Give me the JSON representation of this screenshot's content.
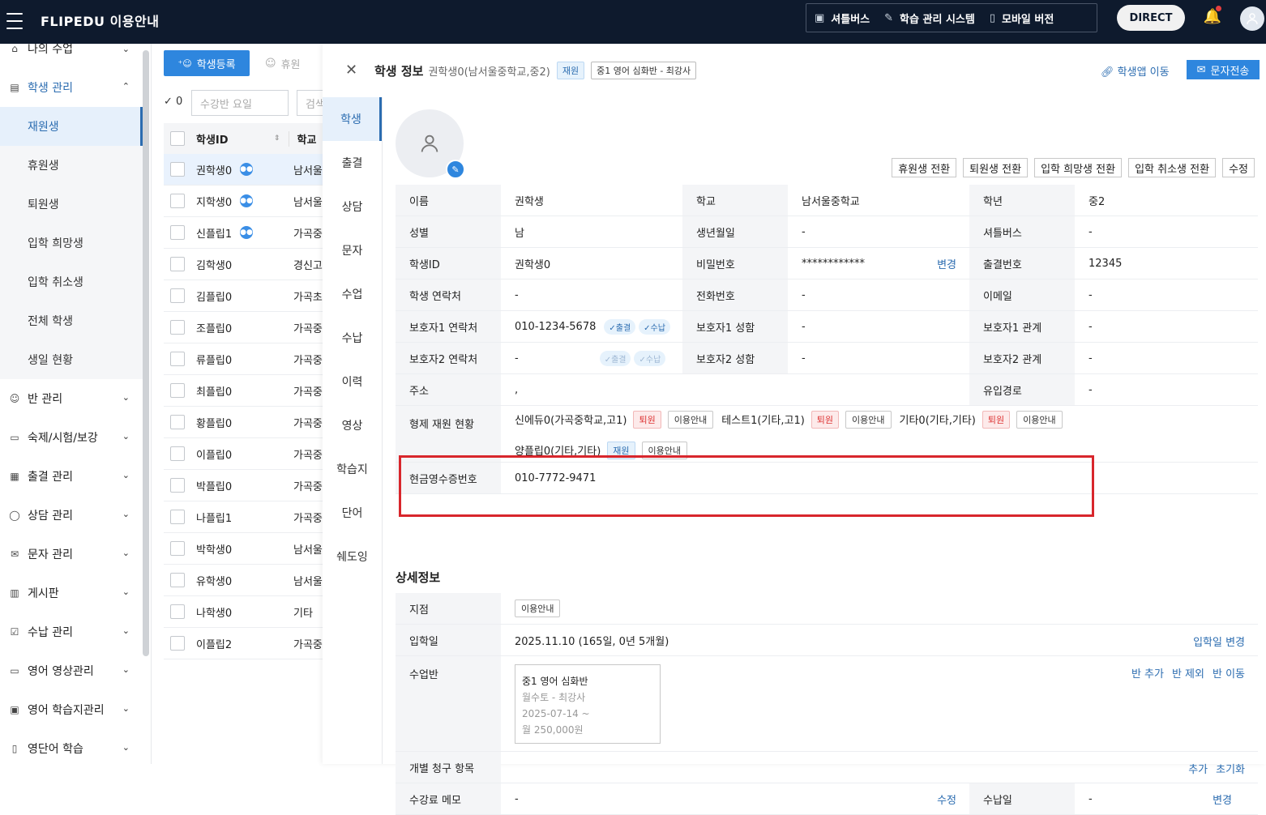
{
  "app": {
    "title": "FLIPEDU 이용안내"
  },
  "topnav": {
    "shuttle": "셔틀버스",
    "lms": "학습 관리 시스템",
    "mobile": "모바일 버전",
    "direct": "DIRECT"
  },
  "sidebar": {
    "my_class": "나의 수업",
    "student_mgmt": "학생 관리",
    "sub": [
      "재원생",
      "휴원생",
      "퇴원생",
      "입학 희망생",
      "입학 취소생",
      "전체 학생",
      "생일 현황"
    ],
    "sections": [
      "반 관리",
      "숙제/시험/보강",
      "출결 관리",
      "상담 관리",
      "문자 관리",
      "게시판",
      "수납 관리",
      "영어 영상관리",
      "영어 학습지관리",
      "영단어 학습"
    ]
  },
  "list": {
    "register": "학생등록",
    "leave": "휴원",
    "check_count": "0",
    "day_placeholder": "수강반 요일",
    "search_placeholder": "검색",
    "col_id": "학생ID",
    "col_school": "학교",
    "rows": [
      {
        "id": "권학생0",
        "school": "남서울",
        "sibling": true
      },
      {
        "id": "지학생0",
        "school": "남서울",
        "sibling": true
      },
      {
        "id": "신플립1",
        "school": "가곡중",
        "sibling": true
      },
      {
        "id": "김학생0",
        "school": "경신고",
        "sibling": false
      },
      {
        "id": "김플립0",
        "school": "가곡초",
        "sibling": false
      },
      {
        "id": "조플립0",
        "school": "가곡중",
        "sibling": false
      },
      {
        "id": "류플립0",
        "school": "가곡중",
        "sibling": false
      },
      {
        "id": "최플립0",
        "school": "가곡중",
        "sibling": false
      },
      {
        "id": "황플립0",
        "school": "가곡중",
        "sibling": false
      },
      {
        "id": "이플립0",
        "school": "가곡중",
        "sibling": false
      },
      {
        "id": "박플립0",
        "school": "가곡중",
        "sibling": false
      },
      {
        "id": "나플립1",
        "school": "가곡중",
        "sibling": false
      },
      {
        "id": "박학생0",
        "school": "남서울",
        "sibling": false
      },
      {
        "id": "유학생0",
        "school": "남서울",
        "sibling": false
      },
      {
        "id": "나학생0",
        "school": "기타",
        "sibling": false
      },
      {
        "id": "이플립2",
        "school": "가곡중",
        "sibling": false
      }
    ]
  },
  "panel": {
    "title": "학생 정보",
    "subtitle": "권학생0(남서울중학교,중2)",
    "status_badge": "재원",
    "class_badge": "중1 영어 심화반 - 최강사",
    "app_move": "학생앱 이동",
    "sms": "문자전송",
    "tabs": [
      "학생",
      "출결",
      "상담",
      "문자",
      "수업",
      "수납",
      "이력",
      "영상",
      "학습지",
      "단어",
      "쉐도잉"
    ],
    "actions": [
      "휴원생 전환",
      "퇴원생 전환",
      "입학 희망생 전환",
      "입학 취소생 전환",
      "수정"
    ],
    "info": {
      "name_k": "이름",
      "name_v": "권학생",
      "school_k": "학교",
      "school_v": "남서울중학교",
      "grade_k": "학년",
      "grade_v": "중2",
      "gender_k": "성별",
      "gender_v": "남",
      "birth_k": "생년월일",
      "birth_v": "-",
      "shuttle_k": "셔틀버스",
      "shuttle_v": "-",
      "sid_k": "학생ID",
      "sid_v": "권학생0",
      "pw_k": "비밀번호",
      "pw_v": "************",
      "pw_change": "변경",
      "attno_k": "출결번호",
      "attno_v": "12345",
      "phone_k": "학생 연락처",
      "phone_v": "-",
      "tel_k": "전화번호",
      "tel_v": "-",
      "email_k": "이메일",
      "email_v": "-",
      "p1_k": "보호자1 연락처",
      "p1_v": "010-1234-5678",
      "p1n_k": "보호자1 성함",
      "p1n_v": "-",
      "p1r_k": "보호자1 관계",
      "p1r_v": "-",
      "p2_k": "보호자2 연락처",
      "p2_v": "-",
      "p2n_k": "보호자2 성함",
      "p2n_v": "-",
      "p2r_k": "보호자2 관계",
      "p2r_v": "-",
      "chip_att": "✓출결",
      "chip_pay": "✓수납",
      "addr_k": "주소",
      "addr_v": ",",
      "inflow_k": "유입경로",
      "inflow_v": "-",
      "sib_k": "형제 재원 현황",
      "siblings": [
        {
          "name": "신에듀0(가곡중학교,고1)",
          "status": "퇴원"
        },
        {
          "name": "테스트1(기타,고1)",
          "status": "퇴원"
        },
        {
          "name": "기타0(기타,기타)",
          "status": "퇴원"
        },
        {
          "name": "양플립0(기타,기타)",
          "status": "재원"
        }
      ],
      "guide": "이용안내",
      "receipt_k": "현금영수증번호",
      "receipt_v": "010-7772-9471"
    },
    "detail": {
      "title": "상세정보",
      "branch_k": "지점",
      "branch_v": "이용안내",
      "enroll_k": "입학일",
      "enroll_v": "2025.11.10 (165일, 0년 5개월)",
      "enroll_change": "입학일 변경",
      "class_k": "수업반",
      "class_card": {
        "name": "중1 영어 심화반",
        "days": "월수토 - 최강사",
        "start": "2025-07-14 ~",
        "fee": "월 250,000원"
      },
      "class_links": [
        "반 추가",
        "반 제외",
        "반 이동"
      ],
      "bill_k": "개별 청구 항목",
      "bill_links": [
        "추가",
        "초기화"
      ],
      "memo_k": "수강료 메모",
      "memo_v": "-",
      "memo_edit": "수정",
      "payday_k": "수납일",
      "payday_v": "-",
      "payday_change": "변경"
    }
  },
  "colors": {
    "topbar": "#0e1a2d",
    "accent": "#2e86de",
    "highlight_box": "#d8262c"
  }
}
